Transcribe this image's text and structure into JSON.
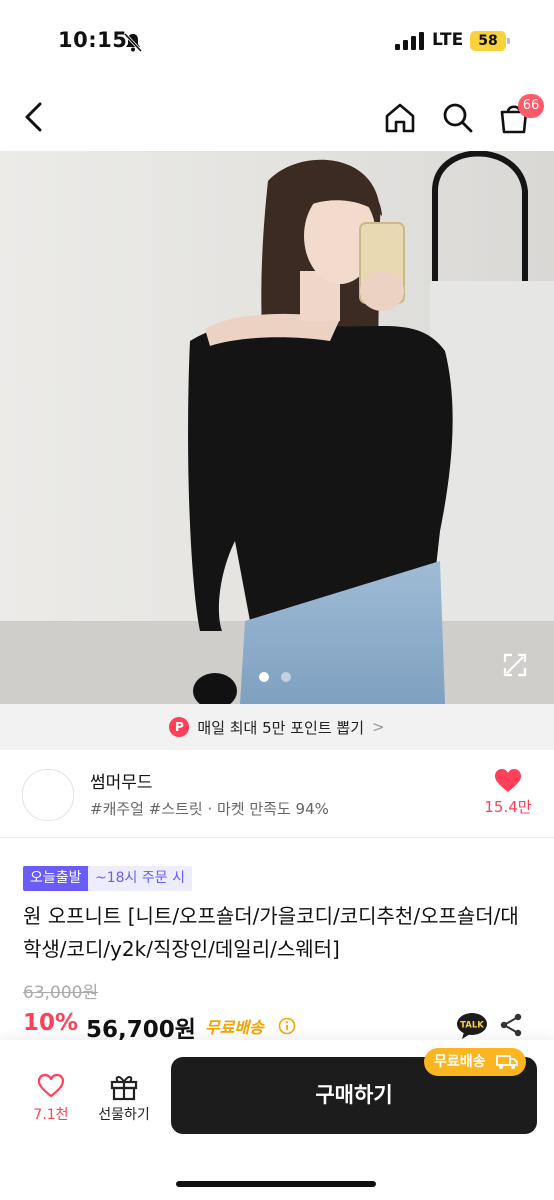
{
  "status_bar": {
    "time": "10:15",
    "network": "LTE",
    "battery": "58"
  },
  "nav": {
    "cart_count": "66"
  },
  "gallery": {
    "slide_count": 2,
    "active_index": 0
  },
  "points_banner": {
    "badge": "P",
    "text": "매일 최대 5만 포인트 뽑기",
    "chevron": ">"
  },
  "store": {
    "name": "썸머무드",
    "tags": "#캐주얼 #스트릿 · 마켓 만족도 94%",
    "likes": "15.4만"
  },
  "badges": {
    "today": "오늘출발",
    "order": "~18시 주문 시"
  },
  "product": {
    "title": "원 오프니트 [니트/오프숄더/가을코디/코디추천/오프숄더/대학생/코디/y2k/직장인/데일리/스웨터]",
    "original_price": "63,000원",
    "discount": "10%",
    "price": "56,700원",
    "shipping": "무료배송",
    "talk": "TALK"
  },
  "bottom": {
    "like_count": "7.1천",
    "gift_label": "선물하기",
    "buy_label": "구매하기",
    "ship_pill": "무료배송"
  },
  "colors": {
    "accent": "#ff4058",
    "purple": "#6a5cf6",
    "gold": "#f0a500",
    "dark": "#1c1c1c"
  }
}
